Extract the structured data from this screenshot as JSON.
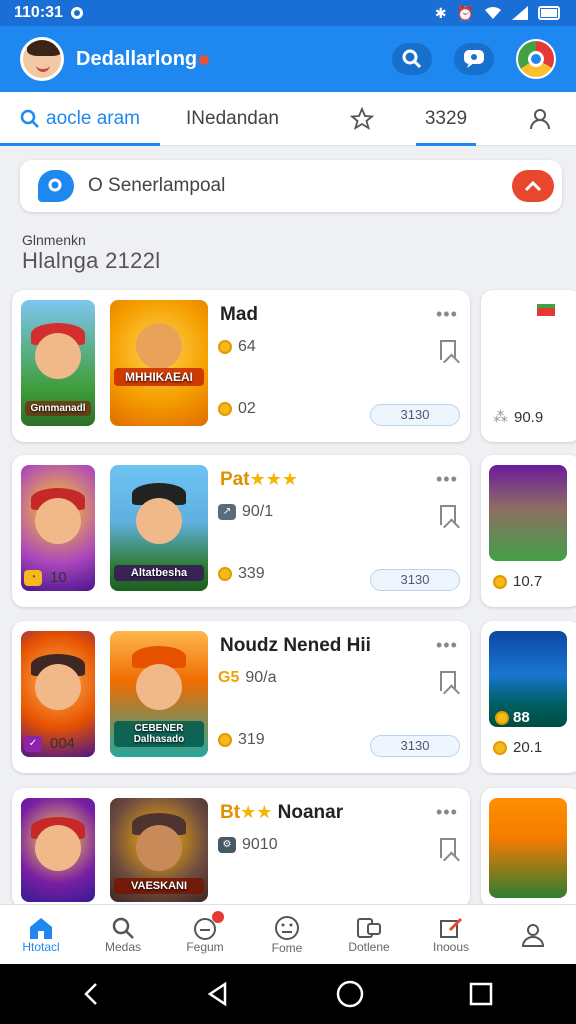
{
  "status_bar": {
    "time": "110:31"
  },
  "app_bar": {
    "title": "Dedallarlong"
  },
  "tabs": [
    {
      "label": "aocle aram"
    },
    {
      "label": "INedandan"
    },
    {
      "label": "3329"
    }
  ],
  "search": {
    "placeholder": "O Senerlampoal"
  },
  "section": {
    "subtitle": "Glnmenkn",
    "title": "Hlalnga 2122l"
  },
  "cards": [
    {
      "thumb_label": "Gnnmanadl",
      "big_label": "MHHIKAEAI",
      "title": "Mad",
      "stat1": "64",
      "stat2": "02",
      "pill": "3130",
      "side_stat": "90.9"
    },
    {
      "thumb_label": "",
      "big_label": "Altatbesha",
      "title": "Pat",
      "stars": "★★★",
      "stat1": "90/1",
      "stat2": "339",
      "left_stat": "10",
      "pill": "3130",
      "side_stat": "10.7"
    },
    {
      "thumb_label": "",
      "big_label": "CEBENER Dalhasado",
      "title": "Noudz Nened Hii",
      "stat1": "90/a",
      "stat1_prefix": "G5",
      "stat2": "319",
      "left_stat": "004",
      "pill": "3130",
      "side_stat": "20.1",
      "side_badge": "88"
    },
    {
      "thumb_label": "",
      "big_label": "VAESKANI",
      "title": "Noanar",
      "title_prefix": "Bt",
      "stars": "★★",
      "stat1": "9010",
      "stat2": "",
      "pill": "",
      "side_stat": ""
    }
  ],
  "bottom_nav": [
    {
      "label": "Htotacl"
    },
    {
      "label": "Medas"
    },
    {
      "label": "Fegum"
    },
    {
      "label": "Fome"
    },
    {
      "label": "Dotlene"
    },
    {
      "label": "Inoous"
    },
    {
      "label": ""
    }
  ],
  "colors": {
    "primary": "#1e88f0",
    "accent": "#e8472e",
    "coin": "#f6b91a"
  }
}
